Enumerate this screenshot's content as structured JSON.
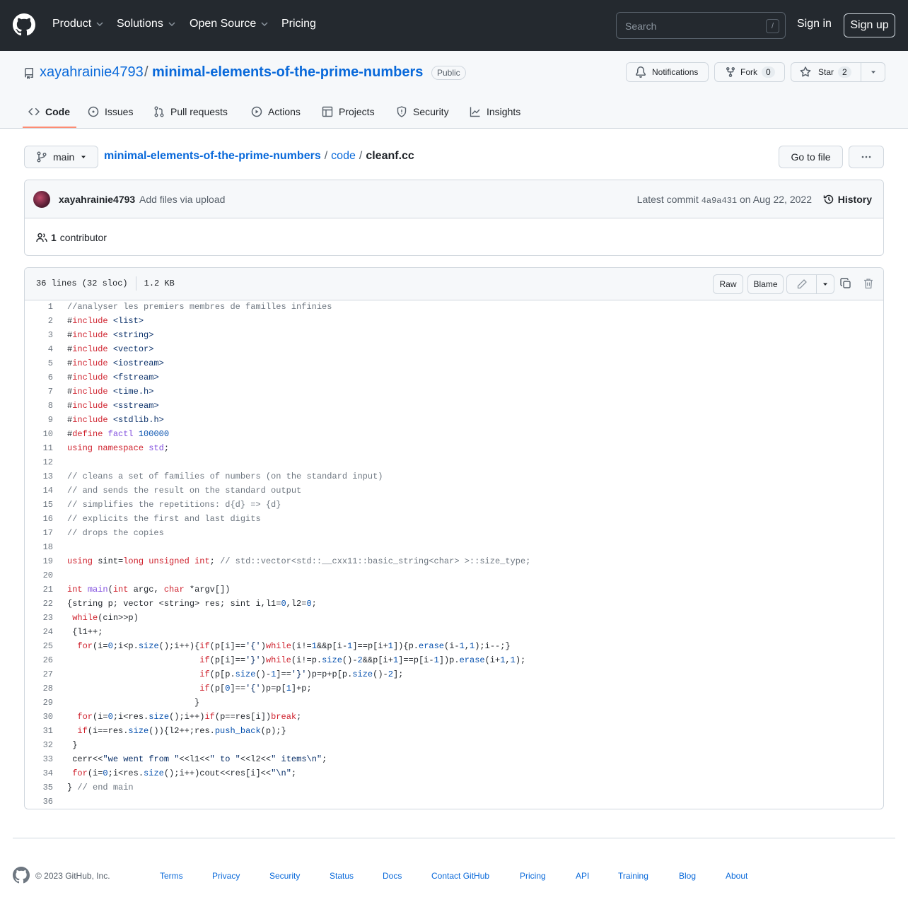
{
  "header": {
    "nav": [
      "Product",
      "Solutions",
      "Open Source",
      "Pricing"
    ],
    "search_placeholder": "Search",
    "search_shortcut": "/",
    "sign_in": "Sign in",
    "sign_up": "Sign up"
  },
  "repo": {
    "owner": "xayahrainie4793",
    "separator": "/",
    "name": "minimal-elements-of-the-prime-numbers",
    "visibility": "Public",
    "notifications_label": "Notifications",
    "fork_label": "Fork",
    "fork_count": "0",
    "star_label": "Star",
    "star_count": "2"
  },
  "tabs": [
    "Code",
    "Issues",
    "Pull requests",
    "Actions",
    "Projects",
    "Security",
    "Insights"
  ],
  "file_nav": {
    "branch": "main",
    "crumbs": [
      "minimal-elements-of-the-prime-numbers",
      "code"
    ],
    "separator": "/",
    "file": "cleanf.cc",
    "go_to_file": "Go to file"
  },
  "commit": {
    "author": "xayahrainie4793",
    "message": "Add files via upload",
    "latest_prefix": "Latest commit",
    "sha": "4a9a431",
    "date_text": "on Aug 22, 2022",
    "history": "History",
    "contributors_count": "1",
    "contributors_label": "contributor"
  },
  "file": {
    "lines_info": "36 lines (32 sloc)",
    "size": "1.2 KB",
    "raw": "Raw",
    "blame": "Blame",
    "code_lines": [
      "//analyser les premiers membres de familles infinies",
      "#include <list>",
      "#include <string>",
      "#include <vector>",
      "#include <iostream>",
      "#include <fstream>",
      "#include <time.h>",
      "#include <sstream>",
      "#include <stdlib.h>",
      "#define factl 100000",
      "using namespace std;",
      "",
      "// cleans a set of families of numbers (on the standard input)",
      "// and sends the result on the standard output",
      "// simplifies the repetitions: d{d} => {d}",
      "// explicits the first and last digits",
      "// drops the copies",
      "",
      "using sint=long unsigned int; // std::vector<std::__cxx11::basic_string<char> >::size_type;",
      "",
      "int main(int argc, char *argv[])",
      "{string p; vector <string> res; sint i,l1=0,l2=0;",
      " while(cin>>p)",
      " {l1++;",
      "  for(i=0;i<p.size();i++){if(p[i]=='{')while(i!=1&&p[i-1]==p[i+1]){p.erase(i-1,1);i--;}",
      "                          if(p[i]=='}')while(i!=p.size()-2&&p[i+1]==p[i-1])p.erase(i+1,1);",
      "                          if(p[p.size()-1]=='}')p=p+p[p.size()-2];",
      "                          if(p[0]=='{')p=p[1]+p;",
      "                         }",
      "  for(i=0;i<res.size();i++)if(p==res[i])break;",
      "  if(i==res.size()){l2++;res.push_back(p);}",
      " }",
      " cerr<<\"we went from \"<<l1<<\" to \"<<l2<<\" items\\n\";",
      " for(i=0;i<res.size();i++)cout<<res[i]<<\"\\n\";",
      "} // end main",
      ""
    ]
  },
  "footer": {
    "copyright": "© 2023 GitHub, Inc.",
    "links": [
      "Terms",
      "Privacy",
      "Security",
      "Status",
      "Docs",
      "Contact GitHub",
      "Pricing",
      "API",
      "Training",
      "Blog",
      "About"
    ]
  }
}
